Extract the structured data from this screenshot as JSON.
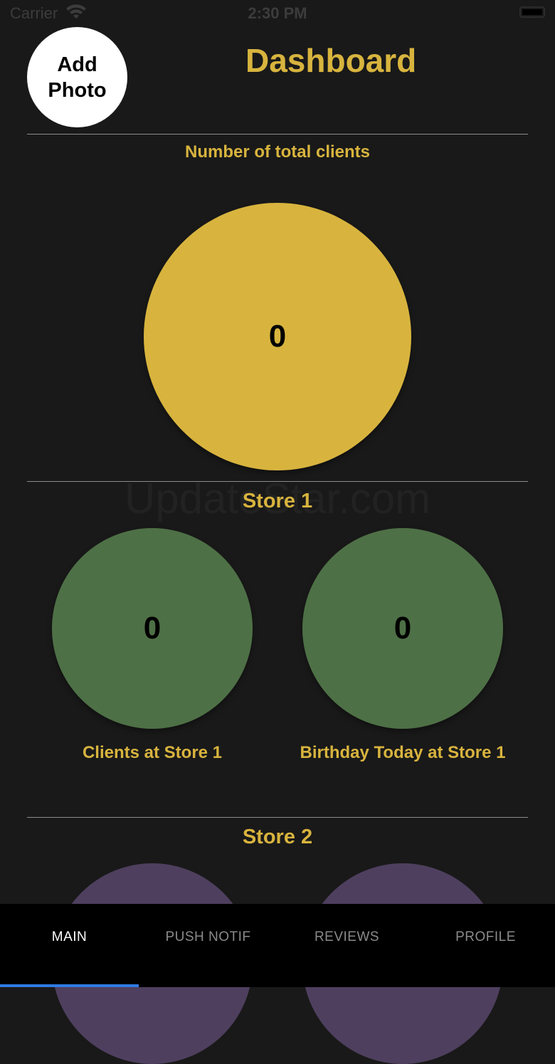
{
  "status_bar": {
    "carrier": "Carrier",
    "time": "2:30 PM"
  },
  "header": {
    "add_photo_label": "Add\nPhoto",
    "title": "Dashboard"
  },
  "total_section": {
    "label": "Number of total clients",
    "value": "0",
    "color": "#d8b43e"
  },
  "watermark": "UpdateStar.com",
  "store1": {
    "title": "Store 1",
    "clients_value": "0",
    "clients_label": "Clients at Store 1",
    "birthday_value": "0",
    "birthday_label": "Birthday Today at Store 1",
    "color": "#4e7046"
  },
  "store2": {
    "title": "Store 2",
    "color": "#4e3f5e"
  },
  "tabs": [
    {
      "label": "MAIN",
      "active": true
    },
    {
      "label": "PUSH NOTIF",
      "active": false
    },
    {
      "label": "REVIEWS",
      "active": false
    },
    {
      "label": "PROFILE",
      "active": false
    }
  ],
  "colors": {
    "accent": "#d8b43e",
    "background": "#191919",
    "tab_active_indicator": "#2f7be3"
  }
}
